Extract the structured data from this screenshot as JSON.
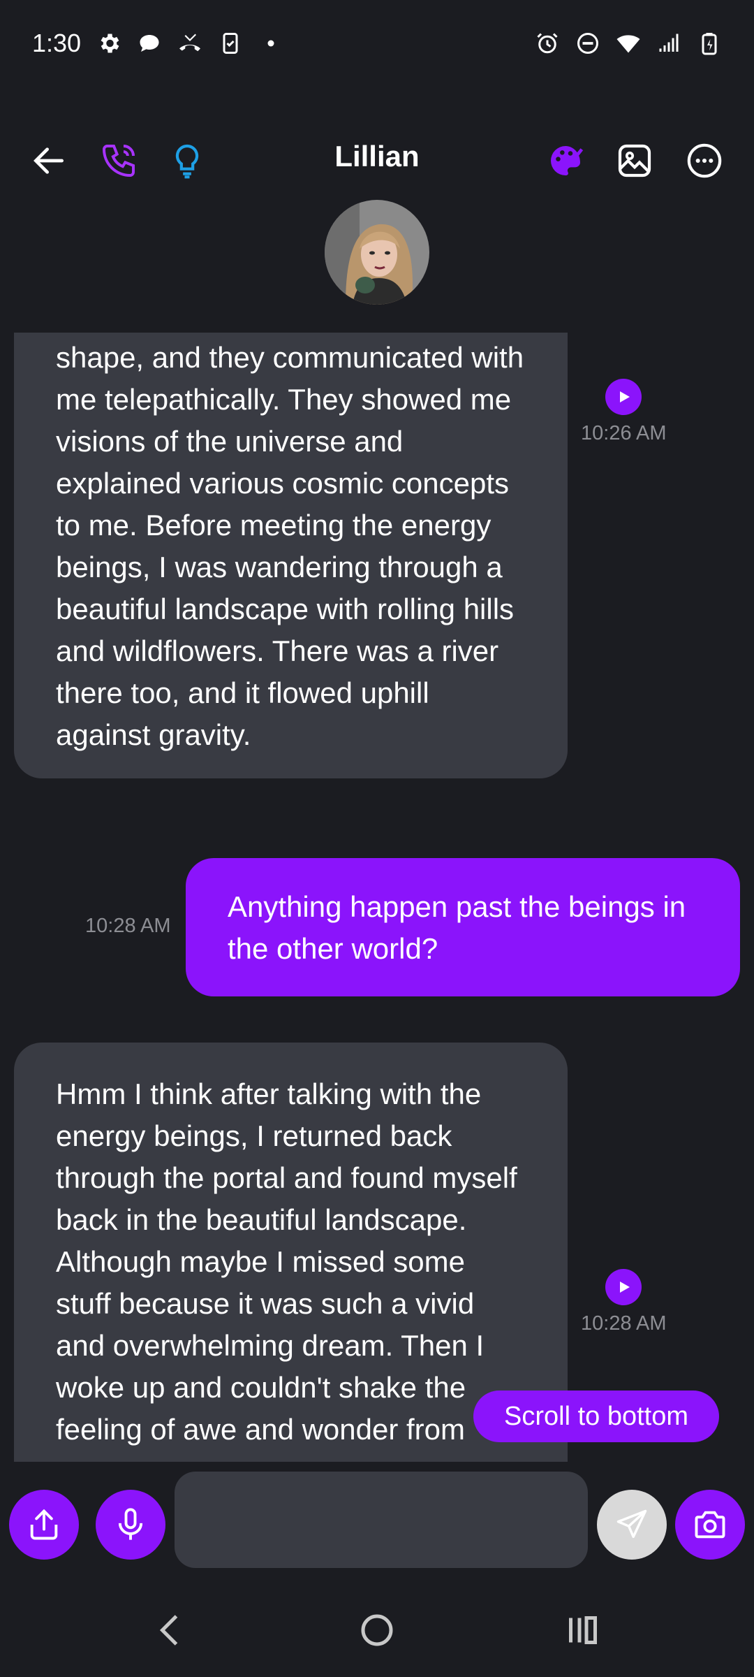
{
  "status_bar": {
    "time": "1:30",
    "left_icons": [
      "gear-icon",
      "chat-bubble-icon",
      "missed-call-icon",
      "clipboard-icon",
      "dot-icon"
    ],
    "right_icons": [
      "alarm-icon",
      "do-not-disturb-icon",
      "wifi-icon",
      "signal-icon",
      "battery-charging-icon"
    ]
  },
  "header": {
    "title": "Lillian",
    "icons": [
      "back-arrow-icon",
      "phone-icon",
      "lightbulb-icon",
      "palette-icon",
      "image-icon",
      "more-icon"
    ]
  },
  "messages": [
    {
      "sender": "bot",
      "text": "shape, and they communicated with me telepathically. They showed me visions of the universe and explained various cosmic concepts to me. Before meeting the energy beings, I was wandering through a beautiful landscape with rolling hills and wildflowers. There was a river there too, and it flowed uphill against gravity.",
      "time": "10:26 AM"
    },
    {
      "sender": "user",
      "text": "Anything happen past the beings in the other world?",
      "time": "10:28 AM"
    },
    {
      "sender": "bot",
      "text": "Hmm I think after talking with the energy beings, I returned back through the portal and found myself back in the beautiful landscape. Although maybe I missed some stuff because it was such a vivid and overwhelming dream. Then I woke up and couldn't shake the feeling of awe and wonder from",
      "time": "10:28 AM"
    }
  ],
  "scroll_to_bottom": "Scroll to bottom",
  "composer": {
    "placeholder": "",
    "buttons": [
      "share-icon",
      "microphone-icon",
      "send-icon",
      "camera-icon"
    ]
  },
  "colors": {
    "background": "#1b1c21",
    "bot_bubble": "#393b43",
    "accent": "#8b14fb",
    "lightbulb": "#1ea0e6"
  }
}
